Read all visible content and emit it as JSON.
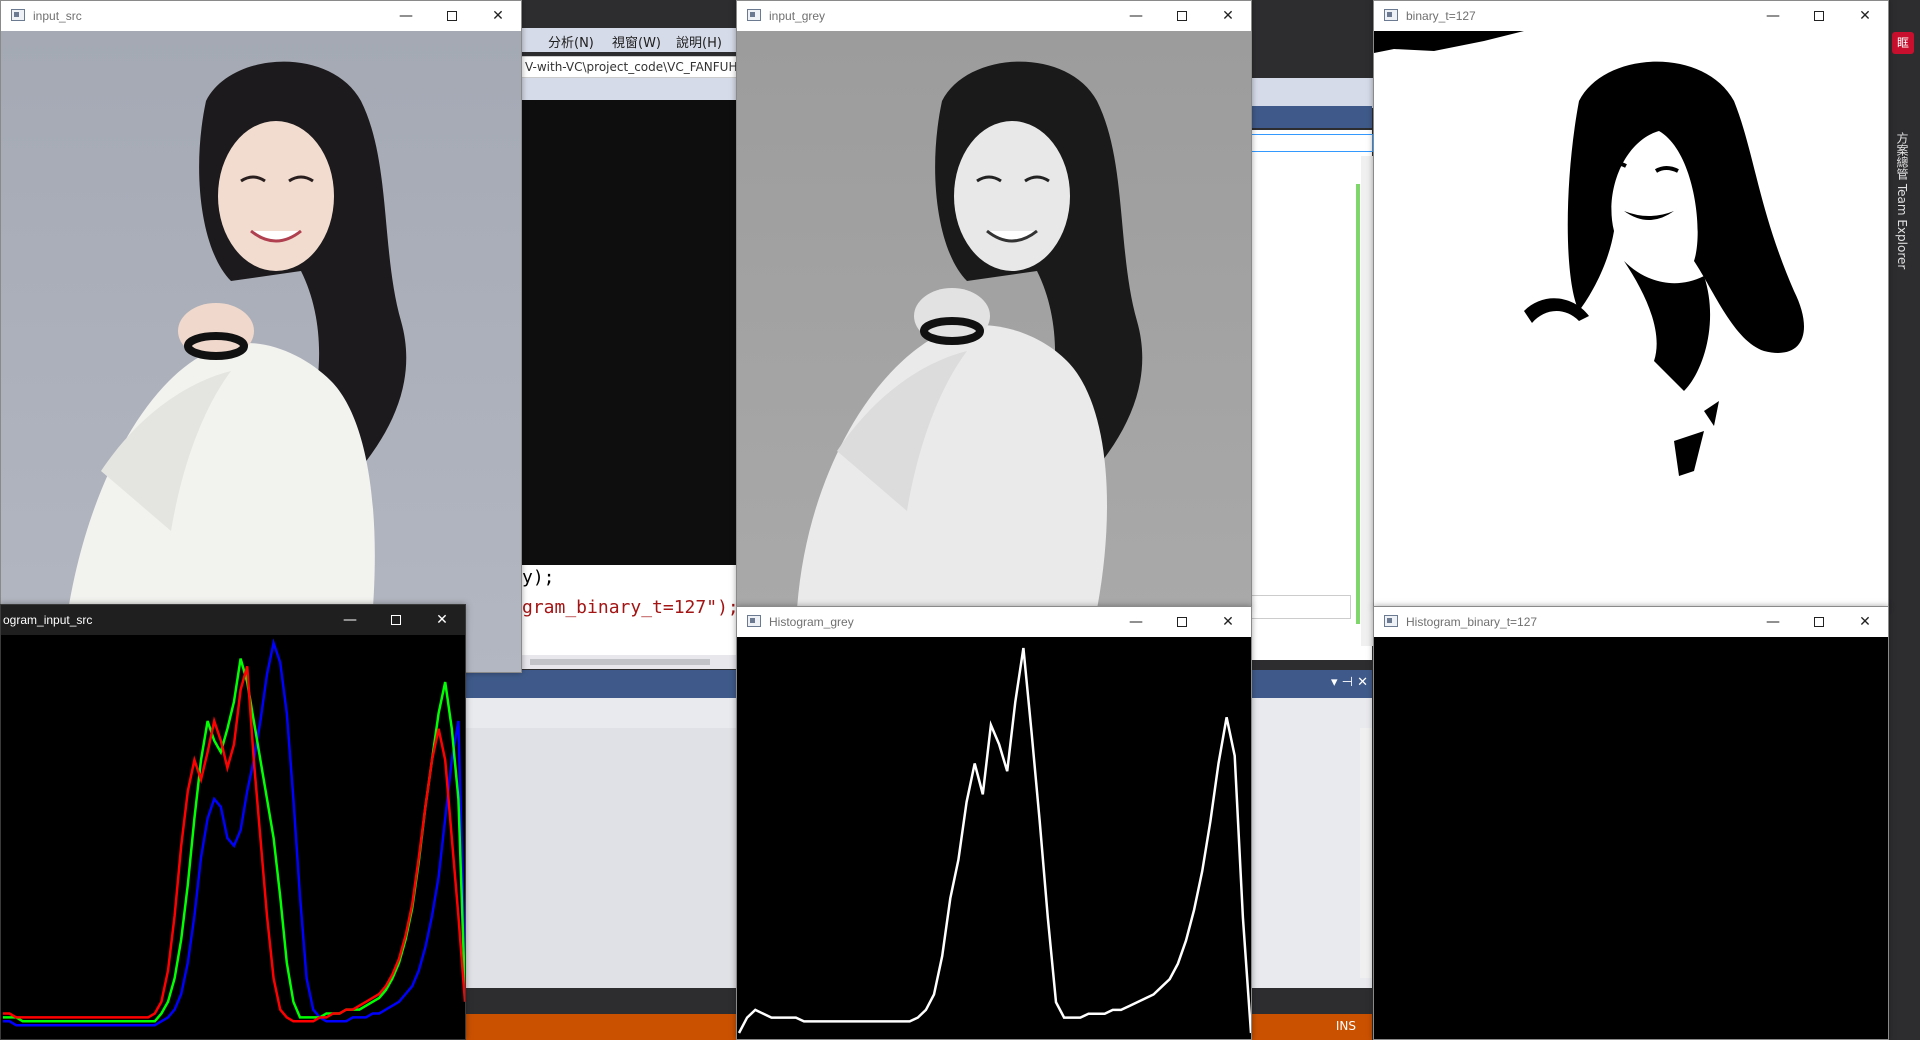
{
  "ide": {
    "menu_items": [
      ")",
      "分析(N)",
      "視窗(W)",
      "說明(H)"
    ],
    "path_text": "V-with-VC\\project_code\\VC_FANFUHA",
    "code_line_1": "y);",
    "code_line_2": "gram_binary_t=127\");",
    "status_text": "INS",
    "panel_glyphs": "▾ ⊣ ✕",
    "side_badge": "眶",
    "side_label": "方案總管  Team Explorer"
  },
  "windows": {
    "input_src": {
      "title": "input_src"
    },
    "input_grey": {
      "title": "input_grey"
    },
    "binary": {
      "title": "binary_t=127"
    },
    "hist_src": {
      "title": "ogram_input_src"
    },
    "hist_grey": {
      "title": "Histogram_grey"
    },
    "hist_binary": {
      "title": "Histogram_binary_t=127"
    }
  },
  "controls": {
    "minimize": "—",
    "close": "✕"
  },
  "colors": {
    "histogram_bg": "#000000",
    "grey_curve": "#ffffff",
    "red_channel": "#ff0000",
    "green_channel": "#00ff00",
    "blue_channel": "#0000ff",
    "status_orange": "#ca5100"
  },
  "chart_data": [
    {
      "type": "line",
      "window": "hist_src",
      "x_range": [
        0,
        255
      ],
      "series": [
        {
          "color": "blue",
          "values": [
            3,
            3,
            2,
            2,
            2,
            2,
            2,
            2,
            2,
            2,
            2,
            2,
            2,
            2,
            2,
            2,
            2,
            2,
            2,
            2,
            2,
            2,
            2,
            2,
            3,
            4,
            6,
            10,
            18,
            30,
            45,
            55,
            60,
            58,
            50,
            48,
            52,
            62,
            70,
            80,
            92,
            100,
            95,
            82,
            60,
            35,
            14,
            6,
            4,
            3,
            3,
            3,
            3,
            4,
            4,
            4,
            5,
            5,
            6,
            7,
            8,
            10,
            12,
            16,
            22,
            30,
            40,
            55,
            70,
            80,
            15
          ]
        },
        {
          "color": "green",
          "values": [
            4,
            4,
            4,
            3,
            3,
            3,
            3,
            3,
            3,
            3,
            3,
            3,
            3,
            3,
            3,
            3,
            3,
            3,
            3,
            3,
            3,
            3,
            3,
            3,
            5,
            8,
            14,
            24,
            38,
            55,
            70,
            80,
            75,
            72,
            78,
            85,
            96,
            90,
            80,
            70,
            60,
            50,
            35,
            18,
            8,
            4,
            4,
            4,
            4,
            5,
            5,
            5,
            6,
            6,
            6,
            7,
            8,
            9,
            11,
            14,
            18,
            24,
            32,
            44,
            58,
            70,
            82,
            90,
            78,
            60,
            10
          ]
        },
        {
          "color": "red",
          "values": [
            5,
            5,
            4,
            4,
            4,
            4,
            4,
            4,
            4,
            4,
            4,
            4,
            4,
            4,
            4,
            4,
            4,
            4,
            4,
            4,
            4,
            4,
            4,
            5,
            8,
            16,
            30,
            48,
            62,
            70,
            65,
            72,
            80,
            75,
            68,
            74,
            88,
            94,
            70,
            50,
            30,
            14,
            6,
            4,
            3,
            3,
            3,
            3,
            4,
            4,
            5,
            5,
            6,
            6,
            7,
            8,
            9,
            10,
            12,
            15,
            19,
            25,
            33,
            45,
            58,
            70,
            78,
            70,
            50,
            30,
            8
          ]
        }
      ]
    },
    {
      "type": "line",
      "window": "hist_grey",
      "x_range": [
        0,
        255
      ],
      "series": [
        {
          "color": "white",
          "values": [
            0,
            4,
            6,
            5,
            4,
            4,
            4,
            4,
            3,
            3,
            3,
            3,
            3,
            3,
            3,
            3,
            3,
            3,
            3,
            3,
            3,
            3,
            4,
            6,
            10,
            20,
            35,
            45,
            60,
            70,
            62,
            80,
            75,
            68,
            86,
            100,
            78,
            55,
            30,
            8,
            4,
            4,
            4,
            5,
            5,
            5,
            6,
            6,
            7,
            8,
            9,
            10,
            12,
            14,
            18,
            24,
            32,
            42,
            55,
            70,
            82,
            72,
            30,
            0
          ]
        }
      ]
    },
    {
      "type": "line",
      "window": "hist_binary",
      "x_range": [
        0,
        255
      ],
      "series": []
    }
  ]
}
